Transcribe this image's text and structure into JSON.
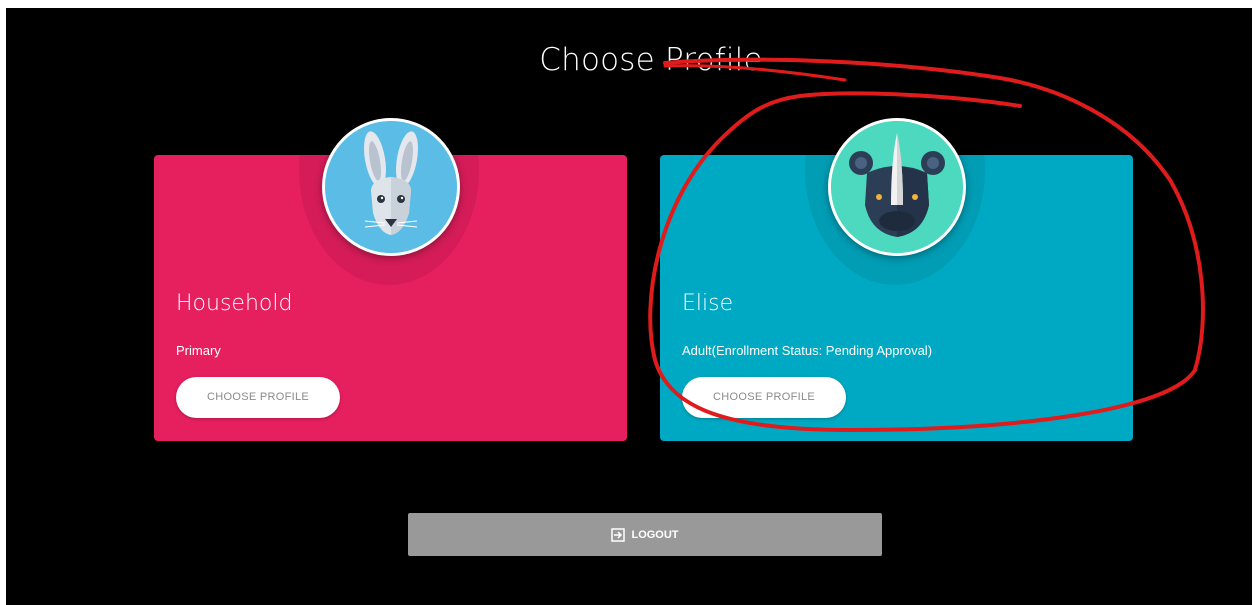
{
  "page": {
    "title": "Choose Profile"
  },
  "profiles": [
    {
      "name": "Household",
      "role": "Primary",
      "button_label": "CHOOSE PROFILE",
      "avatar_icon": "rabbit-icon",
      "card_color": "#e61f5f",
      "avatar_bg": "#5bbde6"
    },
    {
      "name": "Elise",
      "role": "Adult(Enrollment Status: Pending Approval)",
      "button_label": "CHOOSE PROFILE",
      "avatar_icon": "rhino-icon",
      "card_color": "#00a9c3",
      "avatar_bg": "#4dd9bf"
    }
  ],
  "logout": {
    "label": "LOGOUT",
    "icon": "logout-icon"
  },
  "annotation": {
    "color": "#e01b1b",
    "shape": "hand-drawn circle around Elise profile"
  }
}
